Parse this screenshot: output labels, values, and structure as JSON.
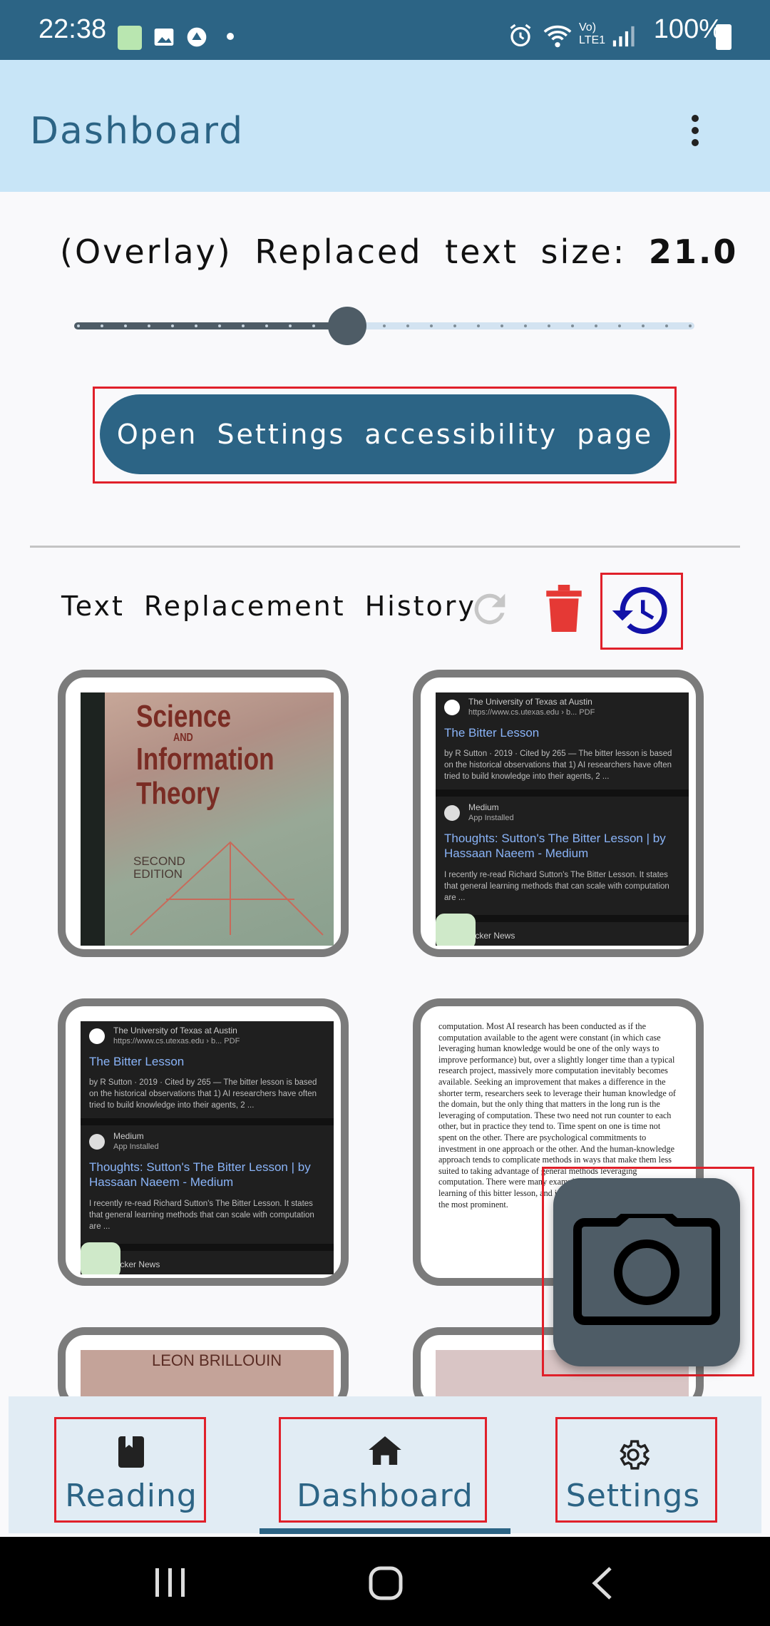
{
  "status_bar": {
    "time": "22:38",
    "battery": "100%",
    "network": "Vo) LTE1"
  },
  "app_bar": {
    "title": "Dashboard",
    "menu_icon": "more-vert-icon"
  },
  "slider": {
    "label": "(Overlay) Replaced text size:",
    "value": "21.0",
    "level_fraction": 0.44
  },
  "open_settings_button": {
    "label": "Open Settings accessibility page"
  },
  "history": {
    "title": "Text Replacement History",
    "icons": [
      "refresh-icon",
      "delete-icon",
      "history-icon"
    ],
    "cards": [
      {
        "type": "book",
        "title_lines": [
          "Science",
          "AND",
          "Information",
          "Theory"
        ],
        "edition": [
          "SECOND",
          "EDITION"
        ]
      },
      {
        "type": "search",
        "result1_source": "The University of Texas at Austin",
        "result1_url": "https://www.cs.utexas.edu › b... PDF",
        "result1_title": "The Bitter Lesson",
        "result1_desc": "by R Sutton · 2019 · Cited by 265 — The bitter lesson is based on the historical observations that 1) AI researchers have often tried to build knowledge into their agents, 2 ...",
        "result2_source": "Medium",
        "result2_sub": "App Installed",
        "result2_title": "Thoughts: Sutton's The Bitter Lesson | by Hassaan Naeem - Medium",
        "result2_desc": "I recently re-read Richard Sutton's The Bitter Lesson. It states that general learning methods that can scale with computation are ...",
        "result3_source": "Hacker News"
      },
      {
        "type": "search",
        "result1_source": "The University of Texas at Austin",
        "result1_url": "https://www.cs.utexas.edu › b... PDF",
        "result1_title": "The Bitter Lesson",
        "result1_desc": "by R Sutton · 2019 · Cited by 265 — The bitter lesson is based on the historical observations that 1) AI researchers have often tried to build knowledge into their agents, 2 ...",
        "result2_source": "Medium",
        "result2_sub": "App Installed",
        "result2_title": "Thoughts: Sutton's The Bitter Lesson | by Hassaan Naeem - Medium",
        "result2_desc": "I recently re-read Richard Sutton's The Bitter Lesson. It states that general learning methods that can scale with computation are ...",
        "result3_source": "Hacker News"
      },
      {
        "type": "paper",
        "text": "computation. Most AI research has been conducted as if the computation available to the agent were constant (in which case leveraging human knowledge would be one of the only ways to improve performance) but, over a slightly longer time than a typical research project, massively more computation inevitably becomes available. Seeking an improvement that makes a difference in the shorter term, researchers seek to leverage their human knowledge of the domain, but the only thing that matters in the long run is the leveraging of computation. These two need not run counter to each other, but in practice they tend to. Time spent on one is time not spent on the other. There are psychological commitments to investment in one approach or the other. And the human-knowledge approach tends to complicate methods in ways that make them less suited to taking advantage of general methods leveraging computation. There were many examples of AI researchers' belated learning of this bitter lesson, and it is instructive to review some of the most prominent."
      },
      {
        "type": "book-partial",
        "title": "LEON BRILLOUIN"
      },
      {
        "type": "paper-partial"
      }
    ]
  },
  "camera_fab": {
    "icon": "camera-icon"
  },
  "bottom_nav": {
    "items": [
      {
        "label": "Reading",
        "icon": "book-icon"
      },
      {
        "label": "Dashboard",
        "icon": "home-icon"
      },
      {
        "label": "Settings",
        "icon": "gear-icon"
      }
    ],
    "selected": "Dashboard"
  },
  "colors": {
    "primary": "#2c6485",
    "app_bar_bg": "#c8e5f7",
    "delete": "#e53935",
    "history": "#1212a8",
    "highlight": "#e0202a"
  }
}
